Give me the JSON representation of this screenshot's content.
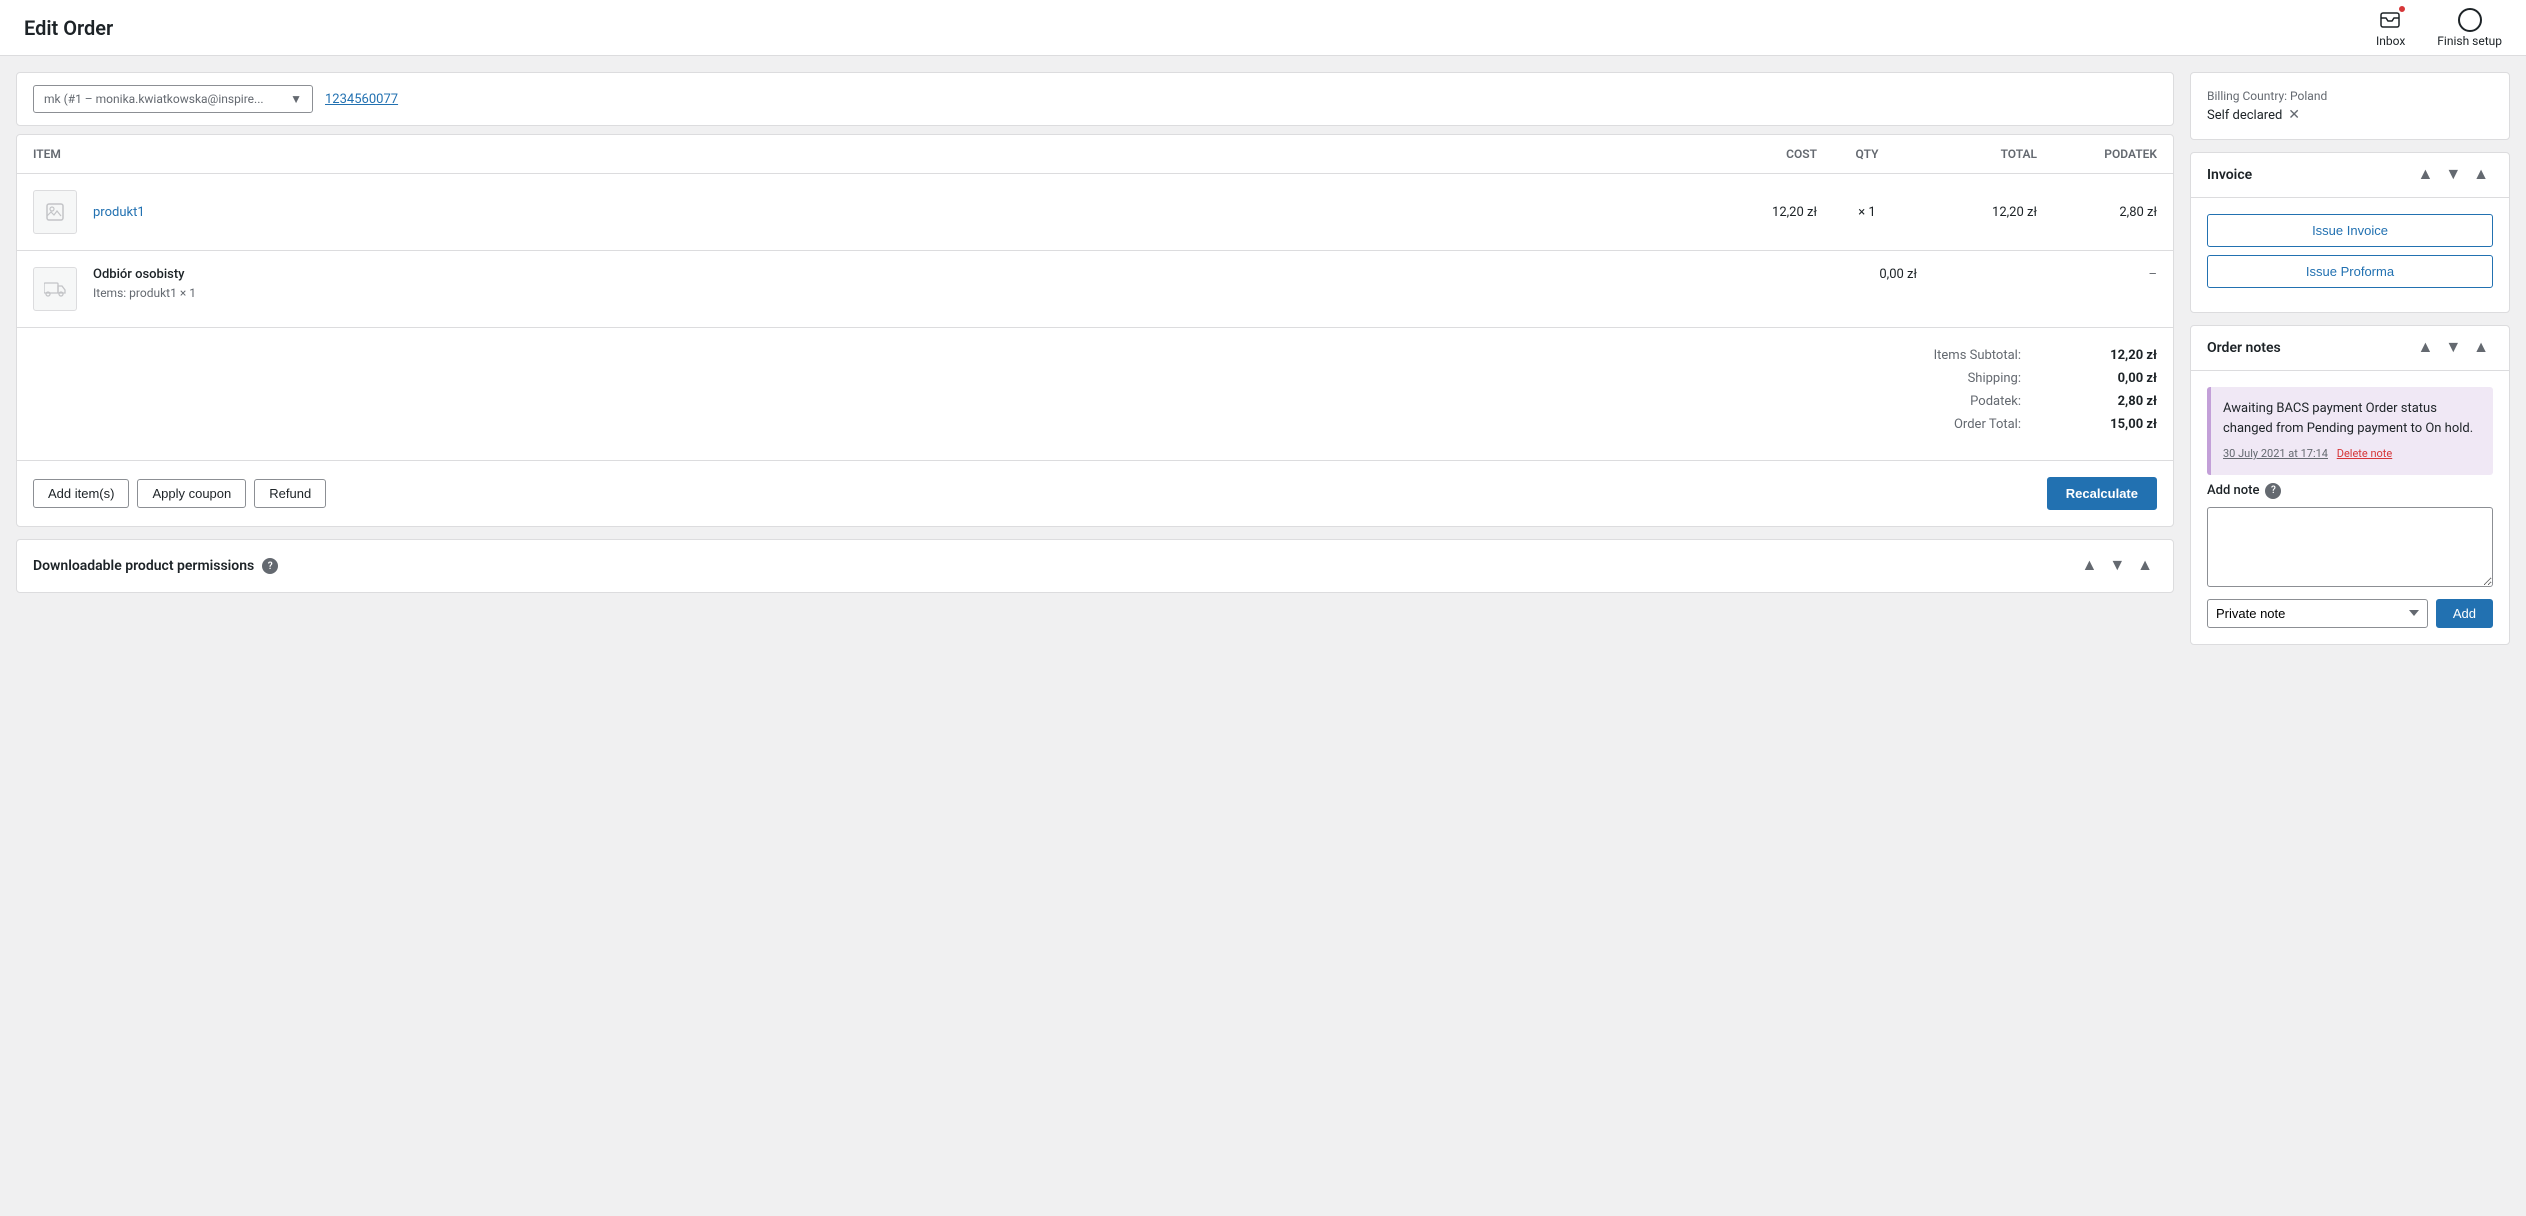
{
  "topBar": {
    "title": "Edit Order",
    "inbox": {
      "label": "Inbox",
      "hasBadge": true
    },
    "setup": {
      "label": "Finish setup"
    }
  },
  "orderHeader": {
    "customerSelectText": "mk (#1 – monika.kwiatkowska@inspire...",
    "orderLink": "1234560077"
  },
  "itemsTable": {
    "headers": {
      "item": "Item",
      "cost": "Cost",
      "qty": "Qty",
      "total": "Total",
      "podatek": "Podatek"
    },
    "products": [
      {
        "name": "produkt1",
        "cost": "12,20 zł",
        "qty": "× 1",
        "total": "12,20 zł",
        "tax": "2,80 zł"
      }
    ],
    "shipping": {
      "name": "Odbiór osobisty",
      "itemsLabel": "Items:",
      "itemsValue": "produkt1 × 1",
      "total": "0,00 zł",
      "tax": "–"
    },
    "totals": {
      "subtotalLabel": "Items Subtotal:",
      "subtotalValue": "12,20 zł",
      "shippingLabel": "Shipping:",
      "shippingValue": "0,00 zł",
      "taxLabel": "Podatek:",
      "taxValue": "2,80 zł",
      "orderTotalLabel": "Order Total:",
      "orderTotalValue": "15,00 zł"
    }
  },
  "actionButtons": {
    "addItems": "Add item(s)",
    "applyCoupon": "Apply coupon",
    "refund": "Refund",
    "recalculate": "Recalculate"
  },
  "downloadable": {
    "title": "Downloadable product permissions"
  },
  "sidebar": {
    "billing": {
      "title": "Billing Country: Poland",
      "selfDeclared": "Self declared"
    },
    "invoice": {
      "title": "Invoice",
      "issueInvoice": "Issue Invoice",
      "issueProforma": "Issue Proforma"
    },
    "orderNotes": {
      "title": "Order notes",
      "notes": [
        {
          "text": "Awaiting BACS payment Order status changed from Pending payment to On hold.",
          "timestamp": "30 July 2021 at 17:14",
          "deleteLabel": "Delete note"
        }
      ],
      "addNote": {
        "label": "Add note",
        "placeholder": "",
        "noteType": "Private note",
        "addButton": "Add"
      }
    }
  },
  "icons": {
    "chevronDown": "▼",
    "chevronUp": "▲",
    "collapse": "▲",
    "inbox": "✉",
    "question": "?",
    "product": "🖼",
    "truck": "🚚"
  }
}
